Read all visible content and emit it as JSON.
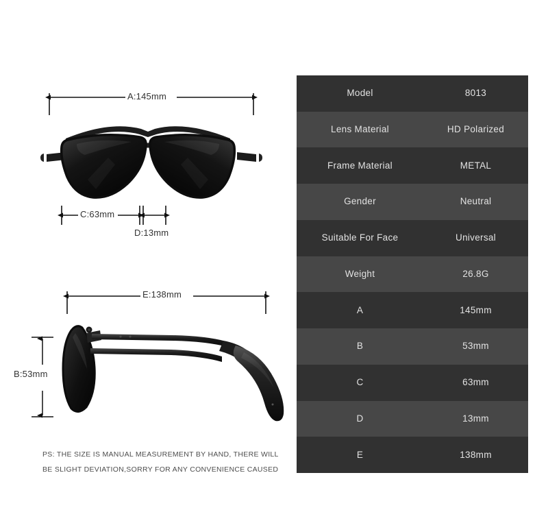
{
  "product": {
    "type": "aviator-sunglasses",
    "front_view_alt": "Front view of black aviator sunglasses with double bridge",
    "side_view_alt": "Side profile view of black aviator sunglasses showing temple arm"
  },
  "dimensions": {
    "a": {
      "code": "A",
      "label": "A:145mm",
      "value": "145mm",
      "orientation": "horizontal",
      "view": "front",
      "description": "Total frame width"
    },
    "b": {
      "code": "B",
      "label": "B:53mm",
      "value": "53mm",
      "orientation": "vertical",
      "view": "side",
      "description": "Lens height"
    },
    "c": {
      "code": "C",
      "label": "C:63mm",
      "value": "63mm",
      "orientation": "horizontal",
      "view": "front",
      "description": "Lens width"
    },
    "d": {
      "code": "D",
      "label": "D:13mm",
      "value": "13mm",
      "orientation": "horizontal",
      "view": "front",
      "description": "Bridge width"
    },
    "e": {
      "code": "E",
      "label": "E:138mm",
      "value": "138mm",
      "orientation": "horizontal",
      "view": "side",
      "description": "Temple arm length"
    }
  },
  "disclaimer": {
    "line1": "PS: THE SIZE IS MANUAL MEASUREMENT BY HAND, THERE WILL",
    "line2": "BE SLIGHT DEVIATION,SORRY FOR ANY CONVENIENCE CAUSED"
  },
  "spec_table": {
    "rows": [
      {
        "key": "Model",
        "value": "8013"
      },
      {
        "key": "Lens Material",
        "value": "HD Polarized"
      },
      {
        "key": "Frame Material",
        "value": "METAL"
      },
      {
        "key": "Gender",
        "value": "Neutral"
      },
      {
        "key": "Suitable For Face",
        "value": "Universal"
      },
      {
        "key": "Weight",
        "value": "26.8G"
      },
      {
        "key": "A",
        "value": "145mm"
      },
      {
        "key": "B",
        "value": "53mm"
      },
      {
        "key": "C",
        "value": "63mm"
      },
      {
        "key": "D",
        "value": "13mm"
      },
      {
        "key": "E",
        "value": "138mm"
      }
    ]
  },
  "colors": {
    "row_dark": "#313131",
    "row_light": "#474747",
    "row_text": "#e2e2e2",
    "diagram_line": "#1a1a1a",
    "label_text": "#333333",
    "disclaimer_text": "#4d4d4d",
    "page_background": "#ffffff"
  }
}
